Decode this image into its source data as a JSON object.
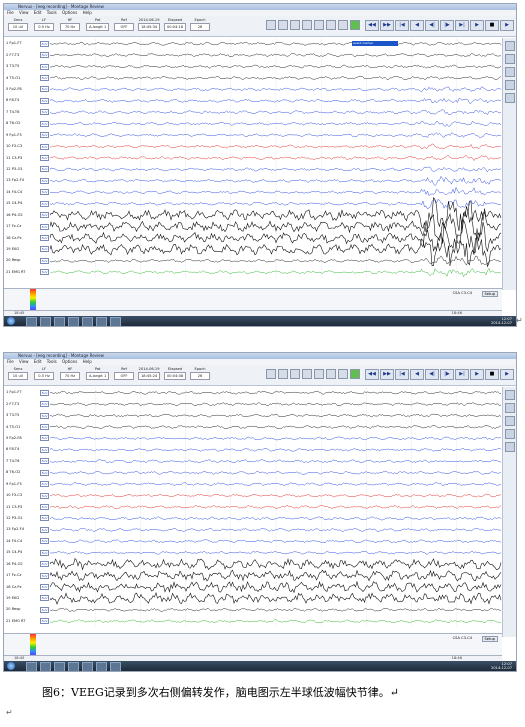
{
  "screenshots": [
    {
      "title": "Nervus - [eeg recording] - Montage Review",
      "menu": [
        "File",
        "View",
        "Edit",
        "Tools",
        "Options",
        "Help"
      ],
      "toolbar": {
        "sens_label": "Sens",
        "sens_value": "10 uV",
        "lff_label": "LF",
        "lff_value": "0.5 Hz",
        "hff_label": "HF",
        "hff_value": "70 Hz",
        "pat_label": "Pat",
        "pat_value": "A-longit 1",
        "ref_label": "Ref",
        "ref_value": "OFF",
        "date": "2014-06-19",
        "time_label": "Elapsed",
        "time_value": "18:45:34",
        "elapsed_value": "00:04:18",
        "epoch_label": "Epoch",
        "epoch_value": "26"
      },
      "channels": [
        "1 Fp1-F7",
        "2 F7-T3",
        "3 T3-T5",
        "4 T5-O1",
        "5 Fp2-F8",
        "6 F8-T4",
        "7 T4-T6",
        "8 T6-O2",
        "9 Fp1-F3",
        "10 F3-C3",
        "11 C3-P3",
        "12 P3-O1",
        "13 Fp2-F4",
        "14 F4-C4",
        "15 C4-P4",
        "16 P4-O2",
        "17 Fz-Cz",
        "18 Cz-Pz",
        "19 EKG",
        "20 Resp",
        "21 EMG RT"
      ],
      "channel_colors": [
        "#111111",
        "#111111",
        "#111111",
        "#111111",
        "#1f3ee0",
        "#1f3ee0",
        "#1f3ee0",
        "#1f3ee0",
        "#1f3ee0",
        "#e02020",
        "#e02020",
        "#1f3ee0",
        "#1f3ee0",
        "#1f3ee0",
        "#1f3ee0",
        "#111111",
        "#111111",
        "#111111",
        "#111111",
        "#111111",
        "#22b022"
      ],
      "channel_box": "5uV",
      "annotation": "event marker",
      "time_ticks": [
        "18:45",
        "18:46"
      ],
      "montage_label": "CSA C3-C4",
      "setup_label": "Setup",
      "tray_time": "12:07",
      "tray_date": "2014-12-07"
    },
    {
      "title": "Nervus - [eeg recording] - Montage Review",
      "menu": [
        "File",
        "View",
        "Edit",
        "Tools",
        "Options",
        "Help"
      ],
      "toolbar": {
        "sens_label": "Sens",
        "sens_value": "10 uV",
        "lff_label": "LF",
        "lff_value": "0.5 Hz",
        "hff_label": "HF",
        "hff_value": "70 Hz",
        "pat_label": "Pat",
        "pat_value": "A-longit 1",
        "ref_label": "Ref",
        "ref_value": "OFF",
        "date": "2014-06-19",
        "time_label": "Elapsed",
        "time_value": "18:45:24",
        "elapsed_value": "00:04:08",
        "epoch_label": "Epoch",
        "epoch_value": "26"
      },
      "channels": [
        "1 Fp1-F7",
        "2 F7-T3",
        "3 T3-T5",
        "4 T5-O1",
        "5 Fp2-F8",
        "6 F8-T4",
        "7 T4-T6",
        "8 T6-O2",
        "9 Fp1-F3",
        "10 F3-C3",
        "11 C3-P3",
        "12 P3-O1",
        "13 Fp2-F4",
        "14 F4-C4",
        "15 C4-P4",
        "16 P4-O2",
        "17 Fz-Cz",
        "18 Cz-Pz",
        "19 EKG",
        "20 Resp",
        "21 EMG RT"
      ],
      "channel_colors": [
        "#111111",
        "#111111",
        "#111111",
        "#111111",
        "#1f3ee0",
        "#1f3ee0",
        "#1f3ee0",
        "#1f3ee0",
        "#1f3ee0",
        "#e02020",
        "#e02020",
        "#1f3ee0",
        "#1f3ee0",
        "#1f3ee0",
        "#1f3ee0",
        "#111111",
        "#111111",
        "#111111",
        "#111111",
        "#111111",
        "#22b022"
      ],
      "channel_box": "5uV",
      "time_ticks": [
        "18:45",
        "18:46"
      ],
      "montage_label": "CSA C3-C4",
      "setup_label": "Setup",
      "tray_time": "12:07",
      "tray_date": "2014-12-07"
    }
  ],
  "caption": "图6：VEEG记录到多次右侧偏转发作，脑电图示左半球低波幅快节律。↵",
  "para_mark": "↵"
}
